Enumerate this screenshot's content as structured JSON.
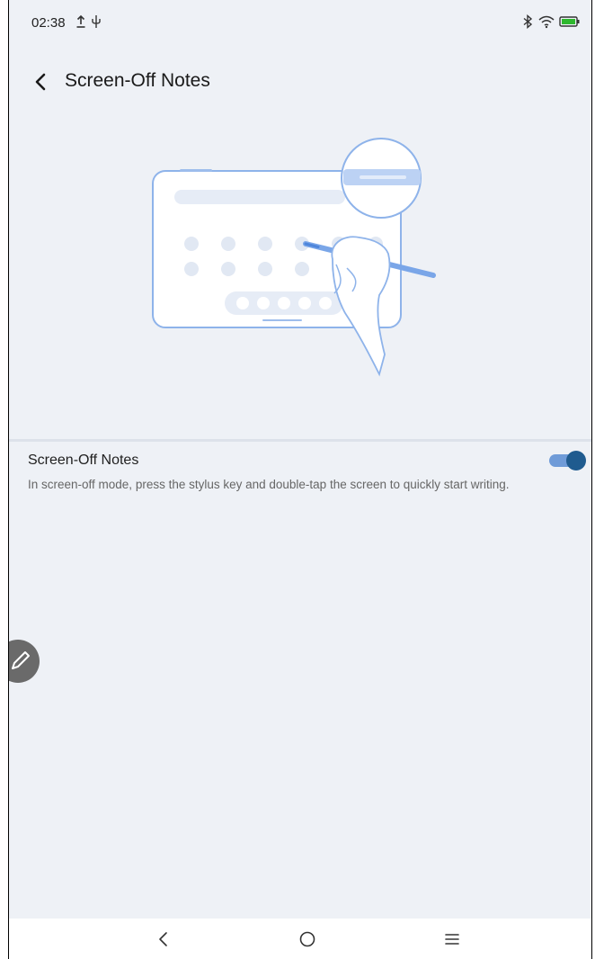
{
  "status_bar": {
    "time": "02:38",
    "left_icons": [
      "upload-icon",
      "usb-icon"
    ],
    "right_icons": [
      "bluetooth-icon",
      "wifi-icon",
      "battery-icon"
    ],
    "battery_color": "#2eb82e"
  },
  "header": {
    "title": "Screen-Off Notes",
    "back_icon": "chevron-left-icon"
  },
  "setting": {
    "title": "Screen-Off Notes",
    "description": "In screen-off mode, press the stylus key and double-tap the screen to quickly start writing.",
    "enabled": true,
    "accent_color": "#1f5b8f"
  },
  "floating_button": {
    "icon": "pen-icon"
  },
  "nav_bar": {
    "buttons": [
      "back-icon",
      "home-icon",
      "menu-icon"
    ]
  }
}
